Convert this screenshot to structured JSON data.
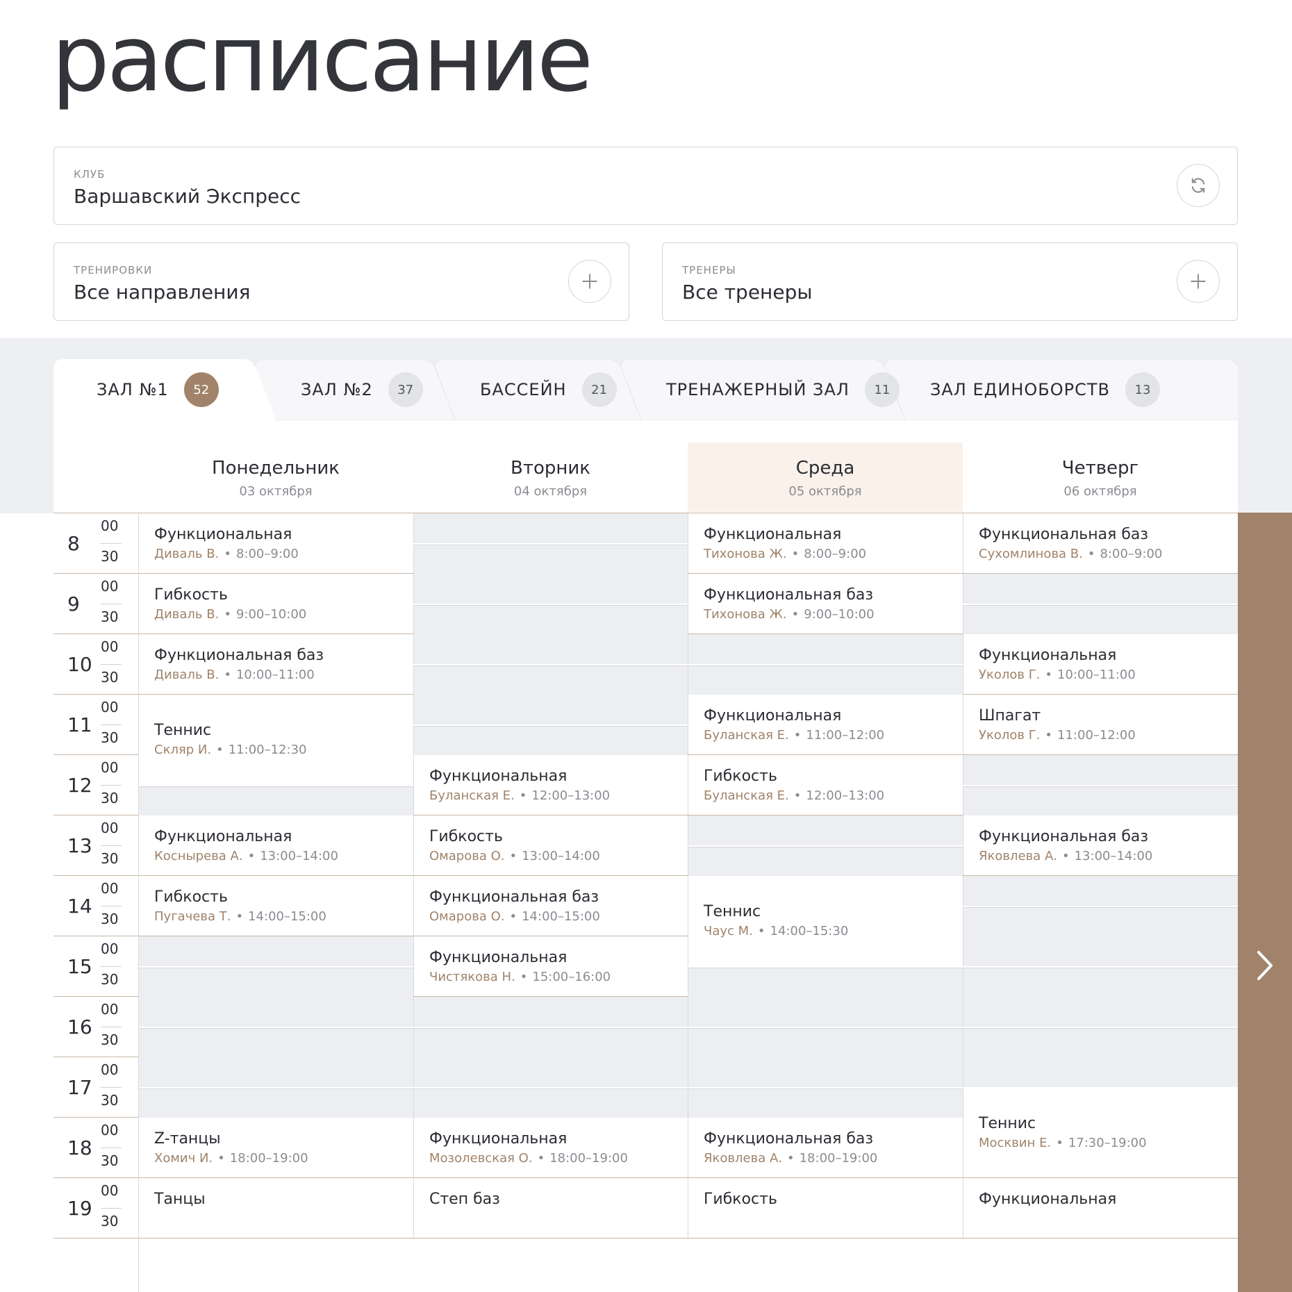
{
  "page": {
    "title": "расписание"
  },
  "filters": {
    "club": {
      "label": "КЛУБ",
      "value": "Варшавский Экспресс",
      "icon": "refresh-icon"
    },
    "trainings": {
      "label": "ТРЕНИРОВКИ",
      "value": "Все направления",
      "icon": "plus-icon"
    },
    "trainers": {
      "label": "ТРЕНЕРЫ",
      "value": "Все тренеры",
      "icon": "plus-icon"
    }
  },
  "tabs": [
    {
      "label": "ЗАЛ №1",
      "count": "52",
      "active": true
    },
    {
      "label": "ЗАЛ №2",
      "count": "37",
      "active": false
    },
    {
      "label": "БАССЕЙН",
      "count": "21",
      "active": false
    },
    {
      "label": "ТРЕНАЖЕРНЫЙ ЗАЛ",
      "count": "11",
      "active": false
    },
    {
      "label": "ЗАЛ ЕДИНОБОРСТВ",
      "count": "13",
      "active": false
    }
  ],
  "days": [
    {
      "name": "Понедельник",
      "date": "03 октября",
      "today": false
    },
    {
      "name": "Вторник",
      "date": "04 октября",
      "today": false
    },
    {
      "name": "Среда",
      "date": "05 октября",
      "today": true
    },
    {
      "name": "Четверг",
      "date": "06 октября",
      "today": false
    }
  ],
  "hours": [
    "8",
    "9",
    "10",
    "11",
    "12",
    "13",
    "14",
    "15",
    "16",
    "17",
    "18",
    "19"
  ],
  "minutes": [
    "00",
    "30"
  ],
  "events": [
    {
      "day": 0,
      "start": 8,
      "end": 9,
      "title": "Функциональная",
      "trainer": "Диваль В.",
      "time": "8:00–9:00"
    },
    {
      "day": 0,
      "start": 9,
      "end": 10,
      "title": "Гибкость",
      "trainer": "Диваль В.",
      "time": "9:00–10:00"
    },
    {
      "day": 0,
      "start": 10,
      "end": 11,
      "title": "Функциональная баз",
      "trainer": "Диваль В.",
      "time": "10:00–11:00"
    },
    {
      "day": 0,
      "start": 11,
      "end": 12.5,
      "title": "Теннис",
      "trainer": "Скляр И.",
      "time": "11:00–12:30"
    },
    {
      "day": 0,
      "start": 13,
      "end": 14,
      "title": "Функциональная",
      "trainer": "Косныревa А.",
      "time": "13:00–14:00"
    },
    {
      "day": 0,
      "start": 14,
      "end": 15,
      "title": "Гибкость",
      "trainer": "Пугачева Т.",
      "time": "14:00–15:00"
    },
    {
      "day": 0,
      "start": 18,
      "end": 19,
      "title": "Z-танцы",
      "trainer": "Хомич И.",
      "time": "18:00–19:00"
    },
    {
      "day": 0,
      "start": 19,
      "end": 20,
      "title": "Танцы",
      "trainer": "",
      "time": ""
    },
    {
      "day": 1,
      "start": 12,
      "end": 13,
      "title": "Функциональная",
      "trainer": "Буланская Е.",
      "time": "12:00–13:00"
    },
    {
      "day": 1,
      "start": 13,
      "end": 14,
      "title": "Гибкость",
      "trainer": "Омарова О.",
      "time": "13:00–14:00"
    },
    {
      "day": 1,
      "start": 14,
      "end": 15,
      "title": "Функциональная баз",
      "trainer": "Омарова О.",
      "time": "14:00–15:00"
    },
    {
      "day": 1,
      "start": 15,
      "end": 16,
      "title": "Функциональная",
      "trainer": "Чистякова Н.",
      "time": "15:00–16:00"
    },
    {
      "day": 1,
      "start": 18,
      "end": 19,
      "title": "Функциональная",
      "trainer": "Мозолевская О.",
      "time": "18:00–19:00"
    },
    {
      "day": 1,
      "start": 19,
      "end": 20,
      "title": "Степ баз",
      "trainer": "",
      "time": ""
    },
    {
      "day": 2,
      "start": 8,
      "end": 9,
      "title": "Функциональная",
      "trainer": "Тихонова Ж.",
      "time": "8:00–9:00"
    },
    {
      "day": 2,
      "start": 9,
      "end": 10,
      "title": "Функциональная баз",
      "trainer": "Тихонова Ж.",
      "time": "9:00–10:00"
    },
    {
      "day": 2,
      "start": 11,
      "end": 12,
      "title": "Функциональная",
      "trainer": "Буланская Е.",
      "time": "11:00–12:00"
    },
    {
      "day": 2,
      "start": 12,
      "end": 13,
      "title": "Гибкость",
      "trainer": "Буланская Е.",
      "time": "12:00–13:00"
    },
    {
      "day": 2,
      "start": 14,
      "end": 15.5,
      "title": "Теннис",
      "trainer": "Чаус М.",
      "time": "14:00–15:30"
    },
    {
      "day": 2,
      "start": 18,
      "end": 19,
      "title": "Функциональная баз",
      "trainer": "Яковлева А.",
      "time": "18:00–19:00"
    },
    {
      "day": 2,
      "start": 19,
      "end": 20,
      "title": "Гибкость",
      "trainer": "",
      "time": ""
    },
    {
      "day": 3,
      "start": 8,
      "end": 9,
      "title": "Функциональная баз",
      "trainer": "Сухомлинова В.",
      "time": "8:00–9:00"
    },
    {
      "day": 3,
      "start": 10,
      "end": 11,
      "title": "Функциональная",
      "trainer": "Уколов Г.",
      "time": "10:00–11:00"
    },
    {
      "day": 3,
      "start": 11,
      "end": 12,
      "title": "Шпагат",
      "trainer": "Уколов Г.",
      "time": "11:00–12:00"
    },
    {
      "day": 3,
      "start": 13,
      "end": 14,
      "title": "Функциональная баз",
      "trainer": "Яковлева А.",
      "time": "13:00–14:00"
    },
    {
      "day": 3,
      "start": 17.5,
      "end": 19,
      "title": "Теннис",
      "trainer": "Москвин Е.",
      "time": "17:30–19:00"
    },
    {
      "day": 3,
      "start": 19,
      "end": 20,
      "title": "Функциональная",
      "trainer": "",
      "time": ""
    }
  ],
  "colors": {
    "accent": "#a0836a",
    "empty": "#eceef1",
    "today": "#f9f1ea",
    "line": "#c9b6a5"
  },
  "nav": {
    "next_icon": "chevron-right-icon"
  }
}
